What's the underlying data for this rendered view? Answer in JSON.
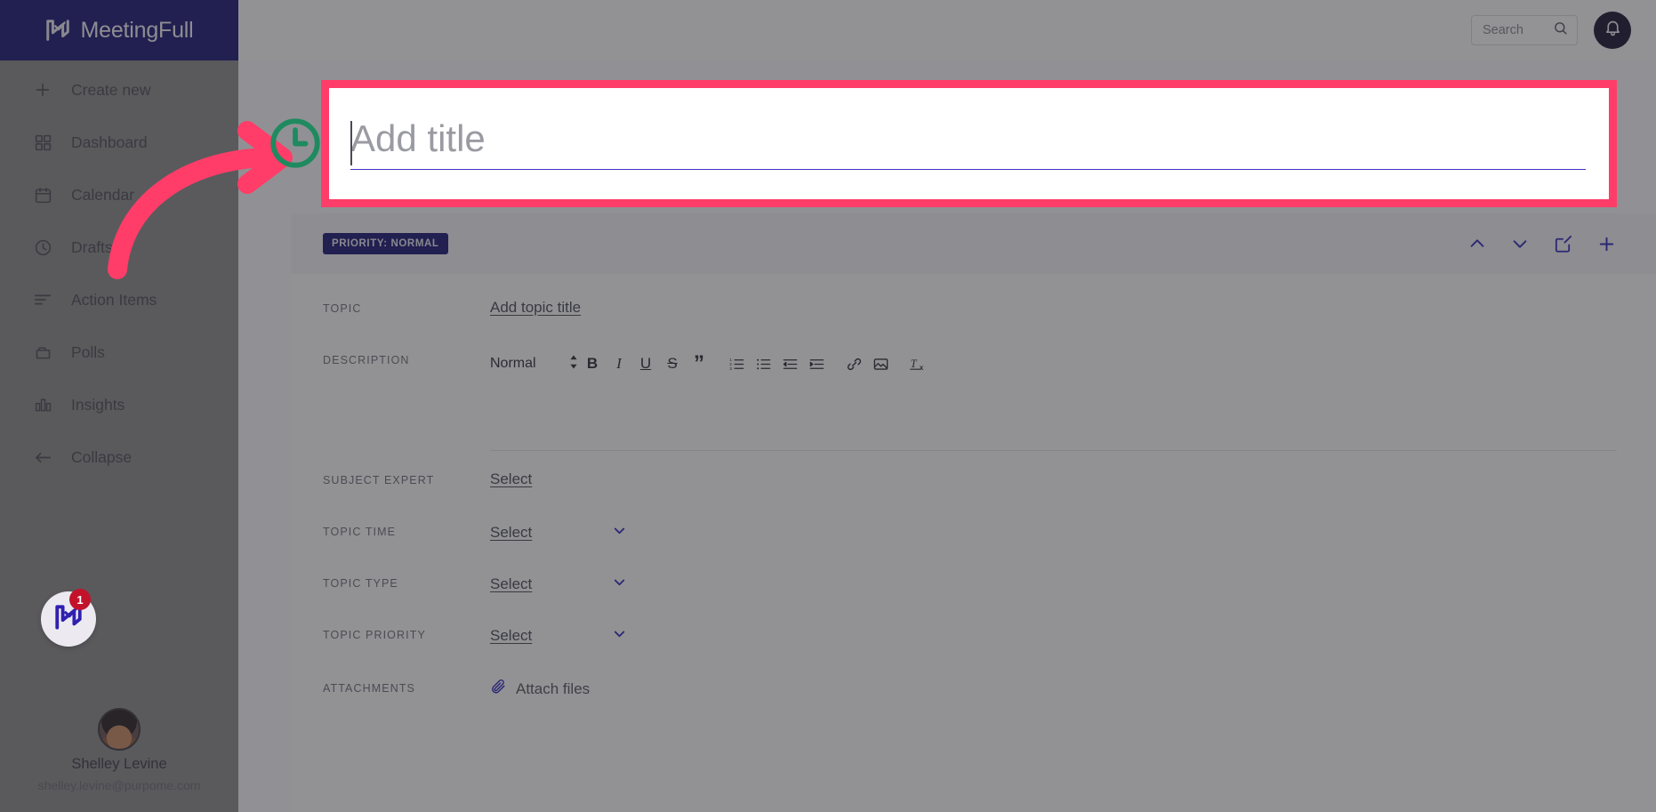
{
  "brand": {
    "name": "MeetingFull",
    "logo_icon": "meetingfull-logo-icon"
  },
  "topbar": {
    "search": {
      "placeholder": "Search",
      "value": "",
      "icon": "search-icon"
    },
    "notification_icon": "bell-icon"
  },
  "sidebar": {
    "items": [
      {
        "label": "Create new",
        "icon": "plus-icon"
      },
      {
        "label": "Dashboard",
        "icon": "grid-icon"
      },
      {
        "label": "Calendar",
        "icon": "calendar-icon"
      },
      {
        "label": "Drafts",
        "icon": "clock-icon"
      },
      {
        "label": "Action Items",
        "icon": "list-lines-icon"
      },
      {
        "label": "Polls",
        "icon": "poll-box-icon"
      },
      {
        "label": "Insights",
        "icon": "bar-chart-icon"
      },
      {
        "label": "Collapse",
        "icon": "arrow-left-icon"
      }
    ],
    "user": {
      "name": "Shelley Levine",
      "email": "shelley.levine@purpome.com",
      "avatar_icon": "user-avatar"
    }
  },
  "main": {
    "title_field": {
      "placeholder": "Add title",
      "value": ""
    },
    "card": {
      "priority_pill": "PRIORITY: NORMAL",
      "actions": [
        {
          "name": "move-up",
          "icon": "chevron-up-icon"
        },
        {
          "name": "move-down",
          "icon": "chevron-down-icon"
        },
        {
          "name": "edit",
          "icon": "square-pen-icon"
        },
        {
          "name": "add",
          "icon": "plus-icon"
        }
      ],
      "fields": {
        "topic": {
          "label": "TOPIC",
          "value": "Add topic title"
        },
        "description": {
          "label": "DESCRIPTION",
          "style_value": "Normal",
          "toolbar": [
            {
              "name": "bold",
              "glyph": "B"
            },
            {
              "name": "italic",
              "glyph": "I"
            },
            {
              "name": "underline",
              "glyph": "U"
            },
            {
              "name": "strikethrough",
              "glyph": "S"
            },
            {
              "name": "blockquote",
              "glyph": "”"
            },
            {
              "name": "ordered-list",
              "glyph": ""
            },
            {
              "name": "bullet-list",
              "glyph": ""
            },
            {
              "name": "outdent",
              "glyph": ""
            },
            {
              "name": "indent",
              "glyph": ""
            },
            {
              "name": "link",
              "glyph": ""
            },
            {
              "name": "image",
              "glyph": ""
            },
            {
              "name": "clear-format",
              "glyph": ""
            }
          ]
        },
        "subject_expert": {
          "label": "SUBJECT EXPERT",
          "value": "Select"
        },
        "topic_time": {
          "label": "TOPIC TIME",
          "value": "Select"
        },
        "topic_type": {
          "label": "TOPIC TYPE",
          "value": "Select"
        },
        "topic_priority": {
          "label": "TOPIC PRIORITY",
          "value": "Select"
        },
        "attachments": {
          "label": "ATTACHMENTS",
          "value": "Attach files",
          "icon": "paperclip-icon"
        }
      }
    }
  },
  "annotation": {
    "highlight_color": "#ff3d68",
    "arrow_icon": "curved-arrow-icon",
    "clock_badge_icon": "clock-icon",
    "clock_badge_color": "#1f8a5f"
  },
  "widget": {
    "logo_icon": "meetingfull-logo-icon",
    "badge_count": "1",
    "badge_color": "#c2132b"
  },
  "colors": {
    "brand_indigo": "#1d1675",
    "accent_pink": "#ff3d68",
    "action_blue": "#2f27b8"
  }
}
